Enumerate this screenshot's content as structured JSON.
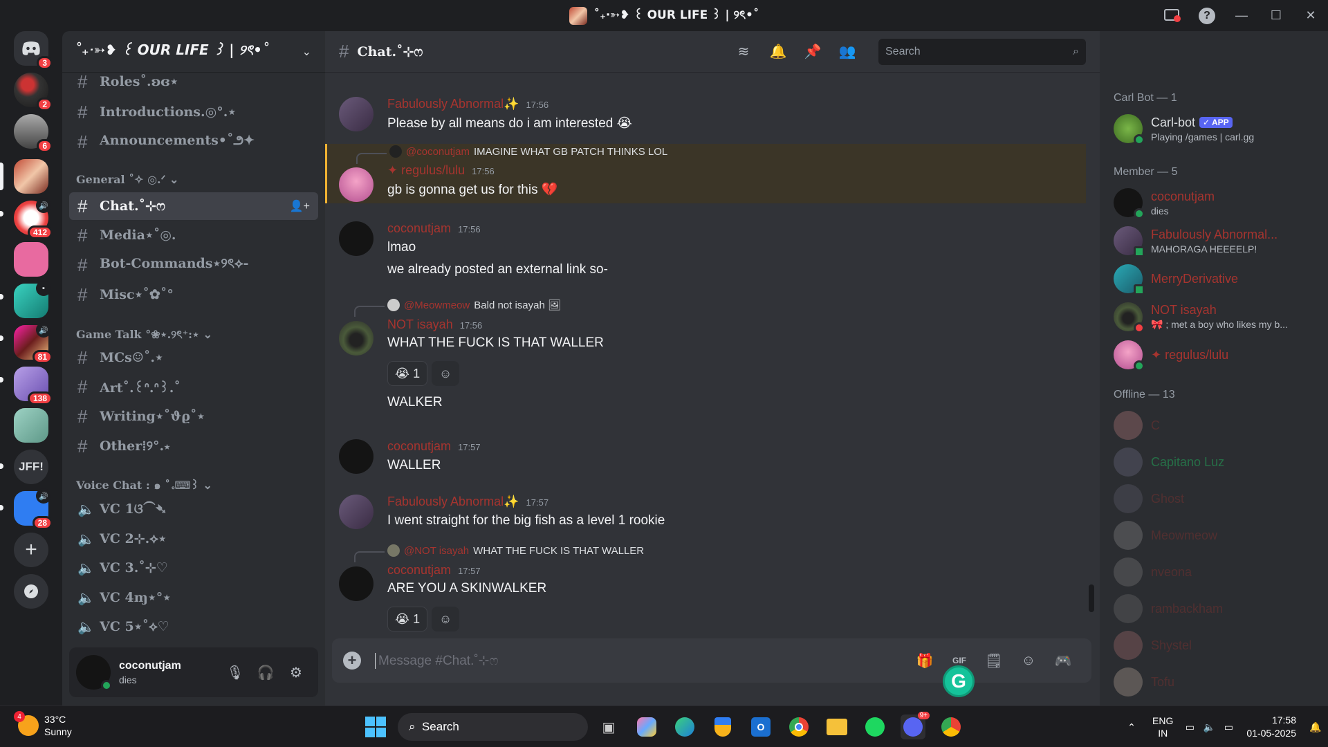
{
  "window": {
    "title": "˚₊‧➳❥ ꒰ OUR LIFE ꒱ | ୨ৎ•˚"
  },
  "rail": {
    "dm_badge": "3",
    "servers": [
      {
        "badge": "2"
      },
      {
        "badge": "6"
      },
      {
        "badge": ""
      },
      {
        "badge": "412"
      },
      {
        "badge": ""
      },
      {
        "badge": ""
      },
      {
        "badge": "81"
      },
      {
        "badge": "138"
      },
      {
        "badge": ""
      },
      {
        "label": "JFF!"
      },
      {
        "badge": "28"
      }
    ]
  },
  "sidebar": {
    "server_name": "˚₊‧➳❥ ꒰ OUR LIFE ꒱ | ୨ৎ•˚",
    "channels_top": [
      "Roles˚.ʚɞ⋆",
      "Introductions.◎°.⋆",
      "Announcements•˚౨✦"
    ],
    "cat_general": "General ˚✧ ◎.ᐟ",
    "channels_general": [
      "Chat.˚⊹ෆ",
      "Media⋆˚◎.",
      "Bot-Commands⋆୨ৎ⟡-",
      "Misc⋆˚✿˚°"
    ],
    "cat_game": "Game Talk °❀⋆.୨ৎ⁺:⋆",
    "channels_game": [
      "MCs☺˚.⋆",
      "Art˚.꒰ᐢ.ᐢ꒱.˚",
      "Writing⋆˚ϑϱ˚⋆",
      "Other⁞୨°.⋆"
    ],
    "cat_voice": "Voice Chat : ๑ ˚｡⌨꒱",
    "channels_voice": [
      "VC 1ଓ⁀➴",
      "VC 2⊹.⟡⋆",
      "VC 3.˚⊹♡",
      "VC 4ɱ⋆°⋆",
      "VC 5⋆˚⟡♡"
    ],
    "user": {
      "name": "coconutjam",
      "status": "dies"
    }
  },
  "chat": {
    "channel": "Chat.˚⊹ෆ",
    "search_placeholder": "Search",
    "composer_placeholder": "Message #Chat.˚⊹ෆ",
    "messages": [
      {
        "author": "Fabulously Abnormal✨",
        "time": "17:56",
        "lines": [
          "Please by all means do i am interested 😭"
        ]
      },
      {
        "reply_to": "@coconutjam",
        "reply_text": "IMAGINE WHAT GB PATCH THINKS LOL",
        "author": "✦ regulus/lulu",
        "time": "17:56",
        "lines": [
          "gb is gonna get us for this 💔"
        ]
      },
      {
        "author": "coconutjam",
        "time": "17:56",
        "lines": [
          "lmao",
          "we already posted an external link so-"
        ]
      },
      {
        "reply_to": "@Meowmeow",
        "reply_text": "Bald not isayah 🖼",
        "author": "NOT isayah",
        "time": "17:56",
        "lines": [
          "WHAT THE FUCK IS THAT WALLER",
          "WALKER"
        ],
        "reaction": "😭",
        "reaction_count": "1"
      },
      {
        "author": "coconutjam",
        "time": "17:57",
        "lines": [
          "WALLER"
        ]
      },
      {
        "author": "Fabulously Abnormal✨",
        "time": "17:57",
        "lines": [
          "I went straight for the big fish as a level 1 rookie"
        ]
      },
      {
        "reply_to": "@NOT isayah",
        "reply_text": "WHAT THE FUCK IS THAT WALLER",
        "author": "coconutjam",
        "time": "17:57",
        "lines": [
          "ARE YOU A SKINWALKER"
        ],
        "reaction": "😭",
        "reaction_count": "1"
      }
    ]
  },
  "members": {
    "group_bot": "Carl Bot — 1",
    "group_member": "Member — 5",
    "group_offline": "Offline — 13",
    "bot": {
      "name": "Carl-bot",
      "tag": "✓ APP",
      "status": "Playing /games | carl.gg"
    },
    "online": [
      {
        "name": "coconutjam",
        "status": "dies"
      },
      {
        "name": "Fabulously Abnormal...",
        "status": "MAHORAGA HEEEELP!"
      },
      {
        "name": "MerryDerivative",
        "status": ""
      },
      {
        "name": "NOT isayah",
        "status": "🎀 ; met a boy who likes my b..."
      },
      {
        "name": "✦ regulus/lulu",
        "status": ""
      }
    ],
    "offline": [
      "C",
      "Capitano Luz",
      "Ghost",
      "Meowmeow",
      "nveona",
      "rambackham",
      "Shystel",
      "Tofu"
    ]
  },
  "taskbar": {
    "weather_badge": "4",
    "temp": "33°C",
    "cond": "Sunny",
    "search": "Search",
    "discord_badge": "9+",
    "lang1": "ENG",
    "lang2": "IN",
    "time": "17:58",
    "date": "01-05-2025"
  },
  "colors": {
    "accent": "#5865f2",
    "name_red": "#a6342f",
    "online": "#23a55a",
    "highlight": "#3b3527"
  }
}
